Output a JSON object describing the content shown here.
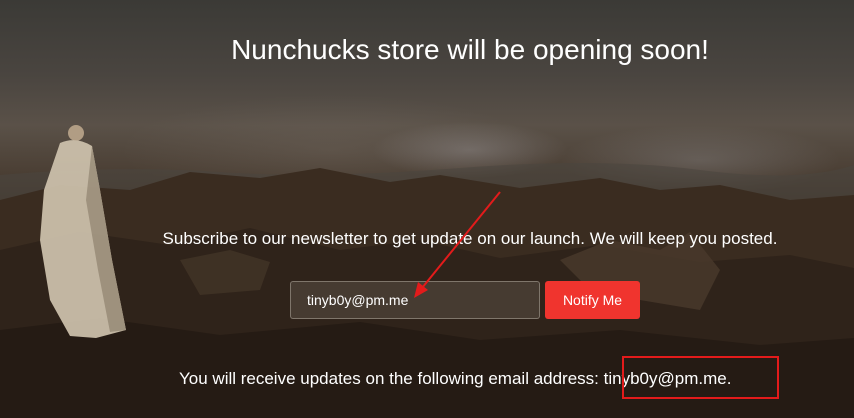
{
  "heading": "Nunchucks store will be opening soon!",
  "subscribe_text": "Subscribe to our newsletter to get update on our launch. We will keep you posted.",
  "email_input": {
    "value": "tinyb0y@pm.me",
    "placeholder": ""
  },
  "notify_button_label": "Notify Me",
  "result": {
    "prefix": "You will receive updates on the following email address: ",
    "email": "tinyb0y@pm.me",
    "suffix": "."
  },
  "colors": {
    "button": "#f0342e",
    "annotation": "#e31b1b"
  },
  "icons": [
    "annotation-arrow-icon"
  ]
}
